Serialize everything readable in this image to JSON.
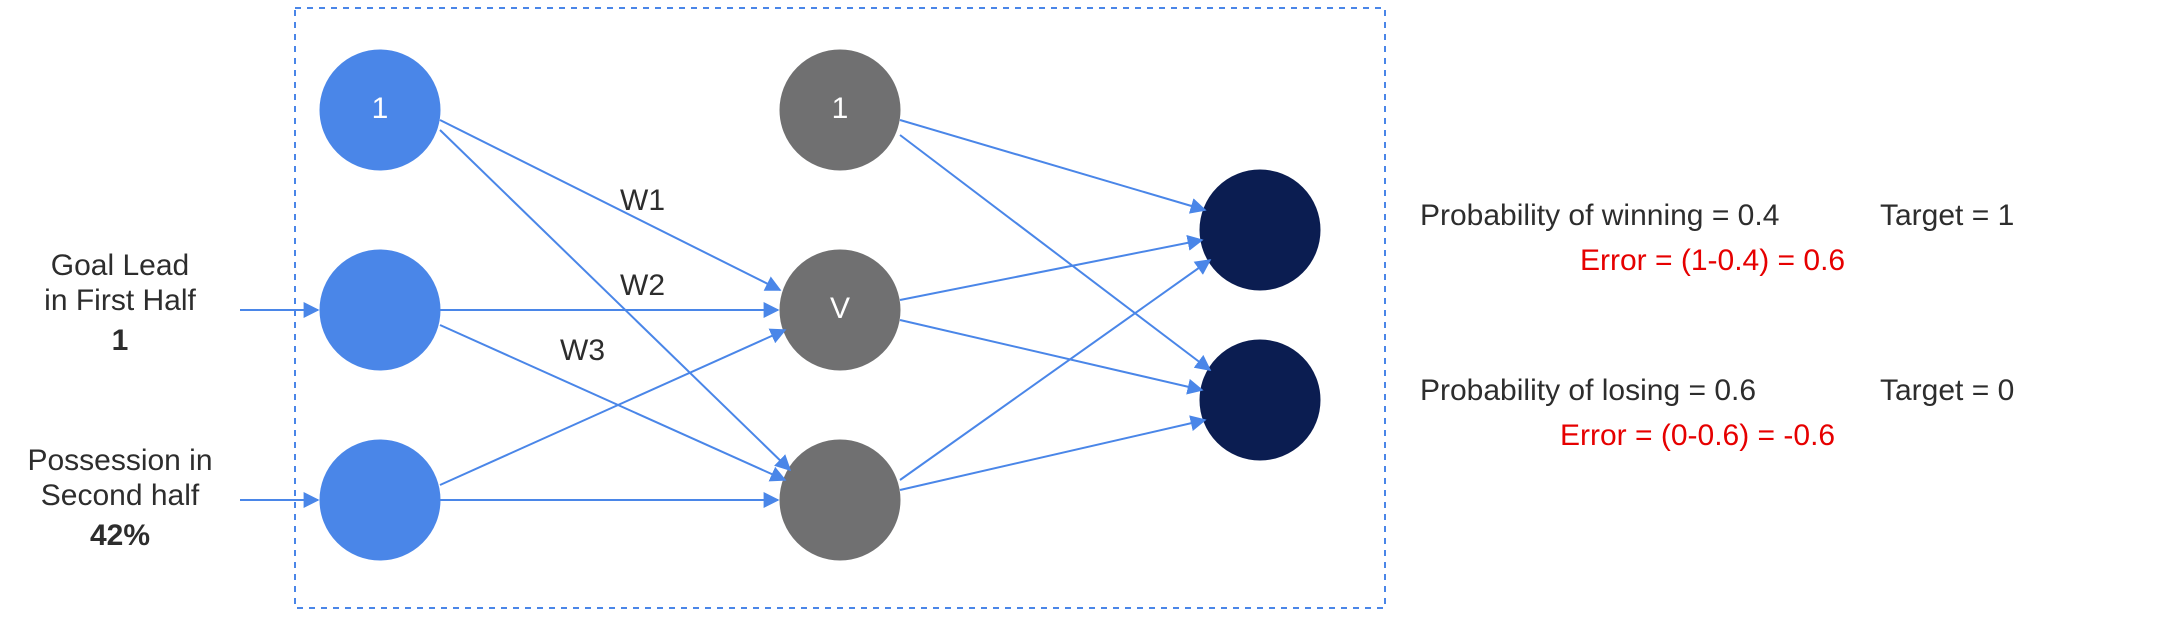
{
  "inputs": {
    "bias_label": "1",
    "feature1_line1": "Goal Lead",
    "feature1_line2": "in First Half",
    "feature1_value": "1",
    "feature2_line1": "Possession in",
    "feature2_line2": "Second half",
    "feature2_value": "42%"
  },
  "hidden": {
    "bias_label": "1",
    "activation_label": "V"
  },
  "weights": {
    "w1": "W1",
    "w2": "W2",
    "w3": "W3"
  },
  "outputs": {
    "win_prob_label": "Probability of winning = 0.4",
    "win_target_label": "Target = 1",
    "win_error_label": "Error = (1-0.4) = 0.6",
    "lose_prob_label": "Probability of losing = 0.6",
    "lose_target_label": "Target = 0",
    "lose_error_label": "Error = (0-0.6) = -0.6"
  },
  "chart_data": {
    "type": "diagram",
    "description": "Feed-forward neural network with 3 input nodes (bias + 2 features), 3 hidden nodes (bias + 2 neurons), 2 output nodes, fully connected with labeled weights W1,W2,W3 into hidden node V, and output probabilities with targets and errors.",
    "layers": [
      {
        "name": "input",
        "nodes": [
          "bias=1",
          "goal_lead_first_half=1",
          "possession_second_half=42%"
        ]
      },
      {
        "name": "hidden",
        "nodes": [
          "bias=1",
          "V",
          "h2"
        ]
      },
      {
        "name": "output",
        "nodes": [
          "P(win)",
          "P(lose)"
        ]
      }
    ],
    "weights_into_V": [
      "W1",
      "W2",
      "W3"
    ],
    "outputs": [
      {
        "name": "P(win)",
        "value": 0.4,
        "target": 1,
        "error": 0.6
      },
      {
        "name": "P(lose)",
        "value": 0.6,
        "target": 0,
        "error": -0.6
      }
    ]
  }
}
